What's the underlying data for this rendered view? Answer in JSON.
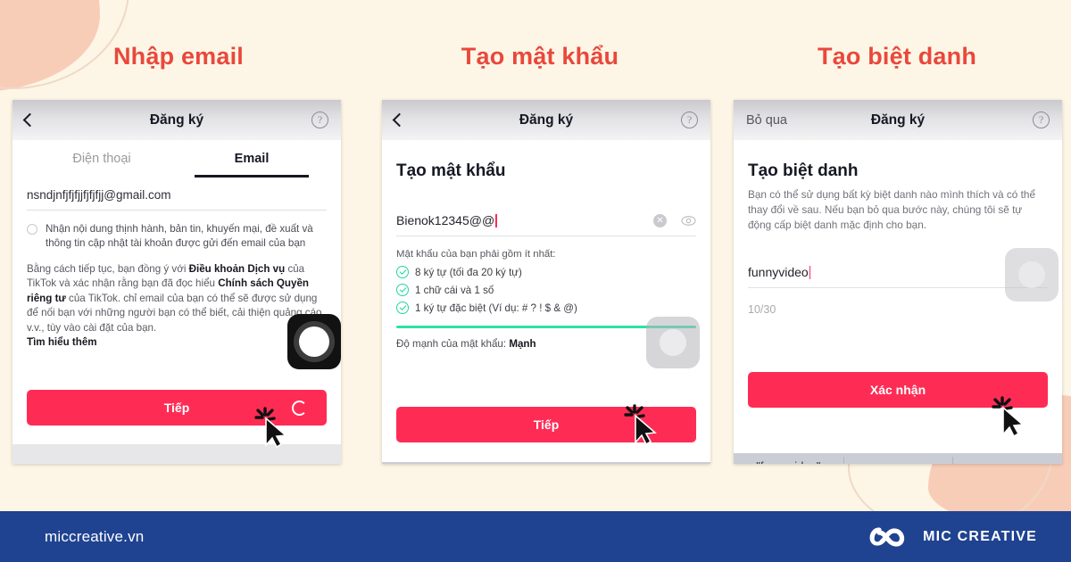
{
  "theme": {
    "background": "#FDF6E6",
    "heading_color": "#E9483C",
    "accent_pink": "#FE2C55",
    "green": "#20D5A0",
    "footer_blue": "#1F4391"
  },
  "headings": {
    "step1": "Nhập email",
    "step2": "Tạo mật khẩu",
    "step3": "Tạo biệt danh"
  },
  "panel1": {
    "nav": {
      "back_icon": "chevron-left-icon",
      "title": "Đăng ký",
      "help_icon": "help-circle-icon"
    },
    "tabs": [
      {
        "label": "Điện thoại",
        "active": false
      },
      {
        "label": "Email",
        "active": true
      }
    ],
    "email_value": "nsndjnfjfjfjjfjfjfjj@gmail.com",
    "consent": "Nhận nội dung thịnh hành, bản tin, khuyến mại, đề xuất và thông tin cập nhật tài khoản được gửi đến email của bạn",
    "legal": {
      "part1": "Bằng cách tiếp tục, bạn đồng ý với ",
      "bold1": "Điều khoản Dịch vụ",
      "part2": " của TikTok và xác nhận rằng bạn đã đọc hiểu ",
      "bold2": "Chính sách Quyền riêng tư",
      "part3": " của TikTok. chỉ email của bạn có thể sẽ được sử dụng để nối bạn với những người bạn có thể biết, cải thiện quảng cáo, v.v., tùy vào cài đặt của bạn.",
      "learn_more": "Tìm hiểu thêm"
    },
    "cta_label": "Tiếp",
    "spinner_icon": "loading-spinner-icon"
  },
  "panel2": {
    "nav": {
      "back_icon": "chevron-left-icon",
      "title": "Đăng ký",
      "help_icon": "help-circle-icon"
    },
    "screen_title": "Tạo mật khẩu",
    "password_value": "Bienok12345@@",
    "clear_icon": "clear-circle-icon",
    "eye_icon": "eye-icon",
    "requirements_title": "Mật khẩu của bạn phải gồm ít nhất:",
    "requirements": [
      "8 ký tự (tối đa 20 ký tự)",
      "1 chữ cái và 1 số",
      "1 ký tự đặc biệt (Ví dụ: # ? ! $ & @)"
    ],
    "strength_label": "Độ mạnh của mật khẩu: ",
    "strength_value": "Mạnh",
    "cta_label": "Tiếp"
  },
  "panel3": {
    "nav": {
      "skip_label": "Bỏ qua",
      "title": "Đăng ký",
      "help_icon": "help-circle-icon"
    },
    "screen_title": "Tạo biệt danh",
    "screen_sub": "Bạn có thể sử dụng bất kỳ biệt danh nào mình thích và có thể thay đổi về sau. Nếu bạn bỏ qua bước này, chúng tôi sẽ tự động cấp biệt danh mặc định cho bạn.",
    "nickname_value": "funnyvideo",
    "counter": "10/30",
    "cta_label": "Xác nhận",
    "keyboard_suggestion": "\"funnyvideo\""
  },
  "footer": {
    "url": "miccreative.vn",
    "brand": "MIC CREATIVE",
    "logo_icon": "infinity-loop-logo-icon"
  }
}
